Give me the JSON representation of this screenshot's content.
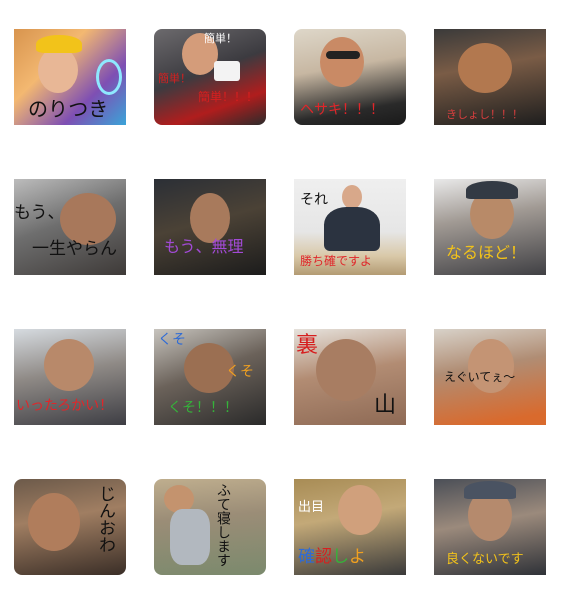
{
  "stickers": [
    {
      "id": "s1",
      "caption": "のりつき",
      "caption_color": "#111111"
    },
    {
      "id": "s2",
      "caption_top": "簡単！",
      "caption_mid": "簡単！",
      "caption_low": "簡単！！！",
      "caption_color": "#d61f1f"
    },
    {
      "id": "s3",
      "caption": "ヘサキ！！！",
      "caption_color": "#e0262a"
    },
    {
      "id": "s4",
      "caption": "きしょし！！！",
      "caption_color": "#d83e3e"
    },
    {
      "id": "s5",
      "caption_top": "もう、",
      "caption_bottom": "一生やらん",
      "caption_color": "#111111"
    },
    {
      "id": "s6",
      "caption": "もう、無理",
      "caption_color": "#a24ad6"
    },
    {
      "id": "s7",
      "caption_top": "それ",
      "caption_bottom": "勝ち確ですよ",
      "caption_color": "#e0262a"
    },
    {
      "id": "s8",
      "caption": "なるほど！",
      "caption_color": "#f2c21a"
    },
    {
      "id": "s9",
      "caption": "いったろかい！",
      "caption_color": "#e0262a"
    },
    {
      "id": "s10",
      "caption_top": "くそ",
      "caption_mid": "くそ",
      "caption_bottom": "くそ！！！",
      "caption_colors": [
        "#2e6bd6",
        "#f0a020",
        "#35b33a"
      ]
    },
    {
      "id": "s11",
      "caption_top": "裏",
      "caption_bottom": "山",
      "caption_colors": [
        "#d61f1f",
        "#111111"
      ]
    },
    {
      "id": "s12",
      "caption": "えぐいてぇ～",
      "caption_color": "#111111"
    },
    {
      "id": "s13",
      "caption": "じんおわ",
      "caption_color": "#111111"
    },
    {
      "id": "s14",
      "caption": "ふて寝します",
      "caption_color": "#111111"
    },
    {
      "id": "s15",
      "caption_top": "出目",
      "caption_bottom_parts": [
        "確",
        "認",
        "し",
        "よ"
      ],
      "caption_colors": [
        "#2e6bd6",
        "#d61f1f",
        "#35b33a",
        "#f0a020"
      ]
    },
    {
      "id": "s16",
      "caption": "良くないです",
      "caption_color": "#f2c21a"
    }
  ]
}
